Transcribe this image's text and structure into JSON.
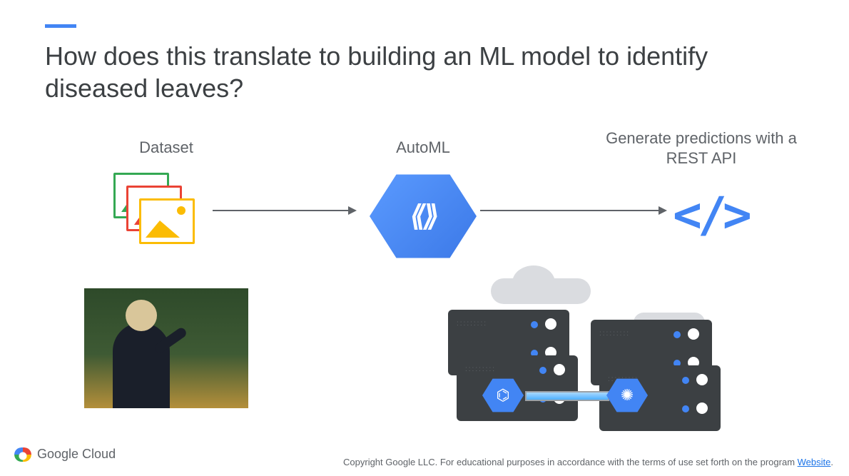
{
  "title": "How does this translate to building an ML model to identify diseased leaves?",
  "flow": {
    "dataset_label": "Dataset",
    "automl_label": "AutoML",
    "api_label": "Generate predictions with a REST API"
  },
  "footer": {
    "brand": "Google Cloud",
    "copyright_prefix": "Copyright Google LLC. For educational purposes in accordance with the terms of use set forth on the program ",
    "link_text": "Website",
    "copyright_suffix": "."
  }
}
